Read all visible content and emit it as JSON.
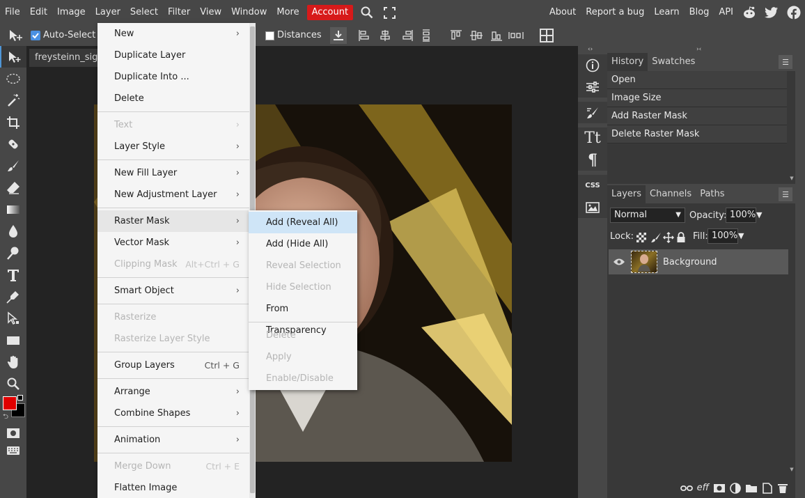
{
  "menubar": {
    "items": [
      "File",
      "Edit",
      "Image",
      "Layer",
      "Select",
      "Filter",
      "View",
      "Window",
      "More"
    ],
    "account": "Account",
    "right_links": [
      "About",
      "Report a bug",
      "Learn",
      "Blog",
      "API"
    ]
  },
  "options": {
    "auto_select": "Auto-Select",
    "distances": "Distances"
  },
  "document": {
    "tab_title": "freysteinn_sign"
  },
  "layer_menu": {
    "items": [
      {
        "label": "New",
        "arrow": true,
        "disabled": false
      },
      {
        "label": "Duplicate Layer",
        "disabled": false
      },
      {
        "label": "Duplicate Into ...",
        "disabled": false
      },
      {
        "label": "Delete",
        "disabled": false
      },
      {
        "label": "Text",
        "arrow": true,
        "disabled": true
      },
      {
        "label": "Layer Style",
        "arrow": true,
        "disabled": false
      },
      {
        "label": "New Fill Layer",
        "arrow": true,
        "disabled": false
      },
      {
        "label": "New Adjustment Layer",
        "arrow": true,
        "disabled": false
      },
      {
        "label": "Raster Mask",
        "arrow": true,
        "disabled": false
      },
      {
        "label": "Vector Mask",
        "arrow": true,
        "disabled": false
      },
      {
        "label": "Clipping Mask",
        "shortcut": "Alt+Ctrl + G",
        "disabled": true
      },
      {
        "label": "Smart Object",
        "arrow": true,
        "disabled": false
      },
      {
        "label": "Rasterize",
        "disabled": true
      },
      {
        "label": "Rasterize Layer Style",
        "disabled": true
      },
      {
        "label": "Group Layers",
        "shortcut": "Ctrl + G",
        "disabled": false
      },
      {
        "label": "Arrange",
        "arrow": true,
        "disabled": false
      },
      {
        "label": "Combine Shapes",
        "arrow": true,
        "disabled": false
      },
      {
        "label": "Animation",
        "arrow": true,
        "disabled": false
      },
      {
        "label": "Merge Down",
        "shortcut": "Ctrl + E",
        "disabled": true
      },
      {
        "label": "Flatten Image",
        "disabled": false
      }
    ]
  },
  "raster_mask_submenu": {
    "items": [
      {
        "label": "Add (Reveal All)",
        "disabled": false,
        "active": true
      },
      {
        "label": "Add (Hide All)",
        "disabled": false
      },
      {
        "label": "Reveal Selection",
        "disabled": true
      },
      {
        "label": "Hide Selection",
        "disabled": true
      },
      {
        "label": "From Transparency",
        "disabled": false
      },
      {
        "label": "Delete",
        "disabled": true
      },
      {
        "label": "Apply",
        "disabled": true
      },
      {
        "label": "Enable/Disable",
        "disabled": true
      }
    ]
  },
  "history_panel": {
    "tabs": [
      "History",
      "Swatches"
    ],
    "entries": [
      "Open",
      "Image Size",
      "Add Raster Mask",
      "Delete Raster Mask"
    ]
  },
  "layers_panel": {
    "tabs": [
      "Layers",
      "Channels",
      "Paths"
    ],
    "blend_mode": "Normal",
    "opacity_label": "Opacity:",
    "opacity_value": "100%",
    "lock_label": "Lock:",
    "fill_label": "Fill:",
    "fill_value": "100%",
    "layers": [
      {
        "name": "Background",
        "visible": true
      }
    ]
  },
  "side_icons": {
    "css_label": "CSS"
  },
  "colors": {
    "foreground": "#e00000",
    "background": "#000000",
    "accent": "#4f95d6",
    "account": "#d71a1a"
  }
}
